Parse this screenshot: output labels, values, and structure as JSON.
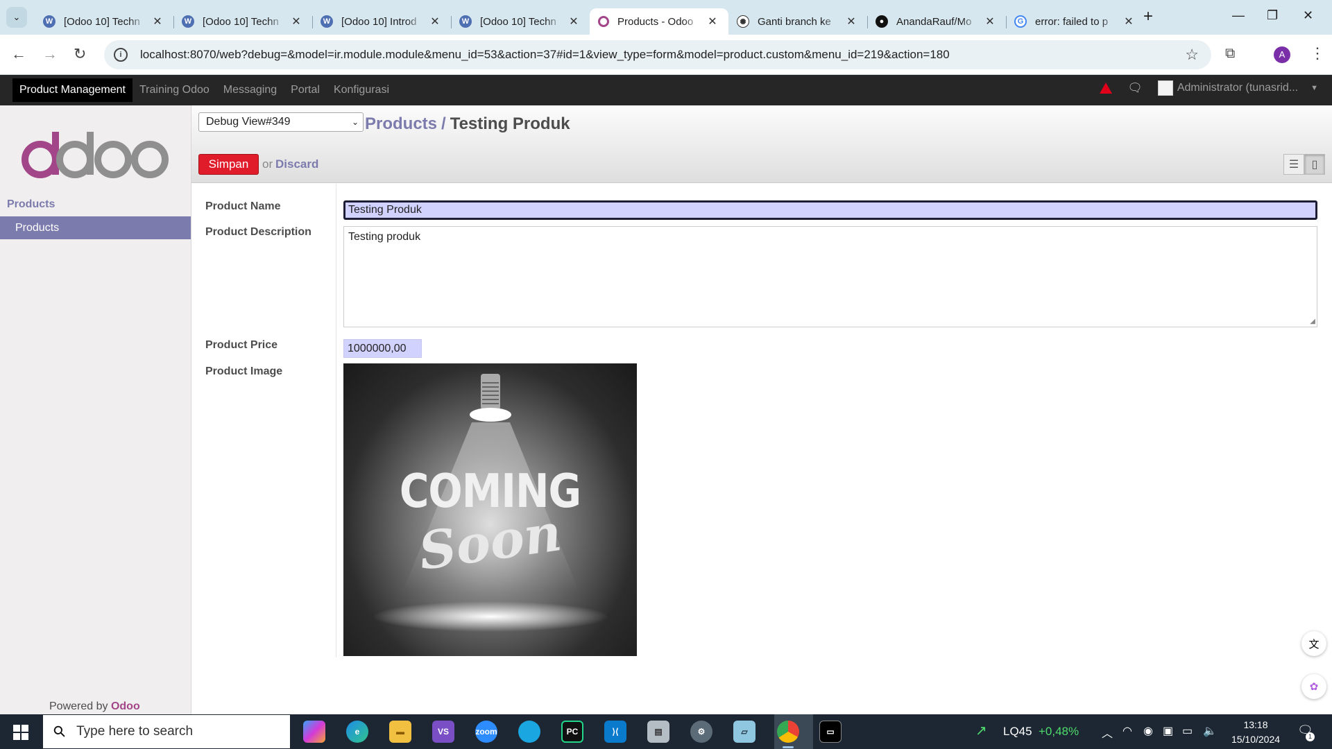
{
  "browser": {
    "tabs": [
      {
        "title": "[Odoo 10] Techn",
        "icon": "wordpress-icon",
        "color": "#4f6fb3"
      },
      {
        "title": "[Odoo 10] Techn",
        "icon": "wordpress-icon",
        "color": "#4f6fb3"
      },
      {
        "title": "[Odoo 10] Introd",
        "icon": "wordpress-icon",
        "color": "#4f6fb3"
      },
      {
        "title": "[Odoo 10] Techn",
        "icon": "wordpress-icon",
        "color": "#4f6fb3"
      },
      {
        "title": "Products - Odoo",
        "icon": "odoo-icon",
        "color": "#a24689",
        "active": true
      },
      {
        "title": "Ganti branch ke",
        "icon": "chatgpt-icon",
        "color": "#333333"
      },
      {
        "title": "AnandaRauf/Mo",
        "icon": "github-icon",
        "color": "#111111"
      },
      {
        "title": "error: failed to p",
        "icon": "google-icon",
        "color": "#4285f4"
      }
    ],
    "url": "localhost:8070/web?debug=&model=ir.module.module&menu_id=53&action=37#id=1&view_type=form&model=product.custom&menu_id=219&action=180",
    "profile_initial": "A"
  },
  "odoo": {
    "top_menu": [
      "Product Management",
      "Training Odoo",
      "Messaging",
      "Portal",
      "Konfigurasi"
    ],
    "user": "Administrator (tunasrid...",
    "sidebar": {
      "section": "Products",
      "item": "Products",
      "powered_by": "Powered by",
      "powered_brand": "Odoo"
    },
    "debug_view": "Debug View#349",
    "breadcrumb": {
      "parent": "Products",
      "separator": "/",
      "current": "Testing Produk"
    },
    "buttons": {
      "save": "Simpan",
      "or": "or",
      "discard": "Discard"
    },
    "form": {
      "name_label": "Product Name",
      "name_value": "Testing Produk",
      "description_label": "Product Description",
      "description_value": "Testing produk",
      "price_label": "Product Price",
      "price_value": "1000000,00",
      "image_label": "Product Image",
      "image_text_line1": "COMING",
      "image_text_line2": "Soon"
    }
  },
  "taskbar": {
    "search_placeholder": "Type here to search",
    "stock_name": "LQ45",
    "stock_change": "+0,48%",
    "time": "13:18",
    "date": "15/10/2024",
    "notification_count": "1"
  }
}
